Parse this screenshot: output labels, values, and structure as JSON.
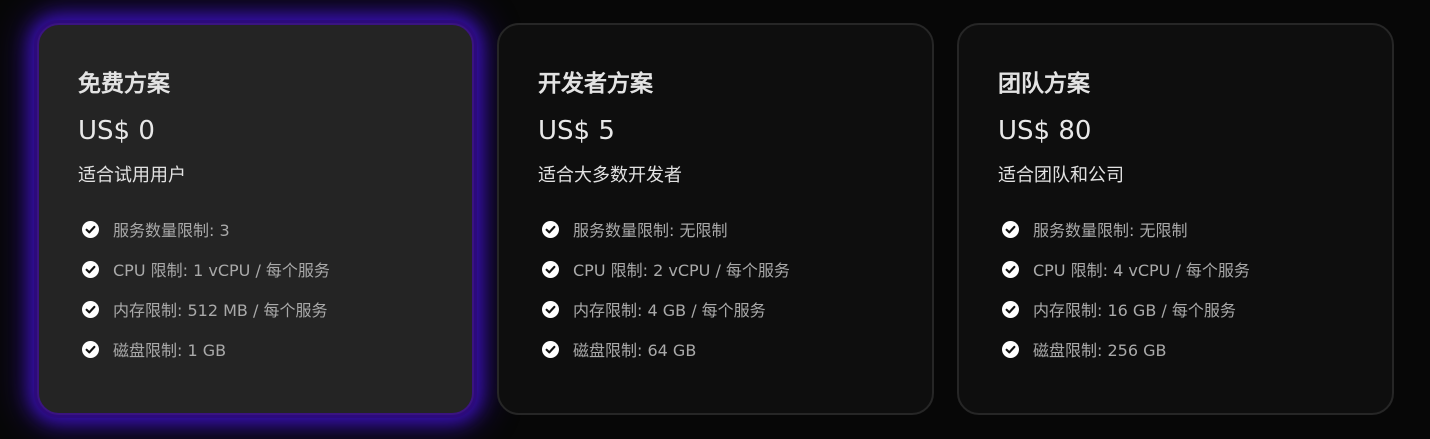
{
  "plans": [
    {
      "name": "免费方案",
      "price": "US$ 0",
      "description": "适合试用用户",
      "features": [
        "服务数量限制: 3",
        "CPU 限制: 1 vCPU / 每个服务",
        "内存限制: 512 MB / 每个服务",
        "磁盘限制: 1 GB"
      ]
    },
    {
      "name": "开发者方案",
      "price": "US$ 5",
      "description": "适合大多数开发者",
      "features": [
        "服务数量限制: 无限制",
        "CPU 限制: 2 vCPU / 每个服务",
        "内存限制: 4 GB / 每个服务",
        "磁盘限制: 64 GB"
      ]
    },
    {
      "name": "团队方案",
      "price": "US$ 80",
      "description": "适合团队和公司",
      "features": [
        "服务数量限制: 无限制",
        "CPU 限制: 4 vCPU / 每个服务",
        "内存限制: 16 GB / 每个服务",
        "磁盘限制: 256 GB"
      ]
    }
  ],
  "icons": {
    "feature": "check-circle-icon"
  },
  "colors": {
    "highlight_glow": "#3a10b8",
    "card_featured_bg": "#242424",
    "card_bg": "#0e0e0e"
  }
}
